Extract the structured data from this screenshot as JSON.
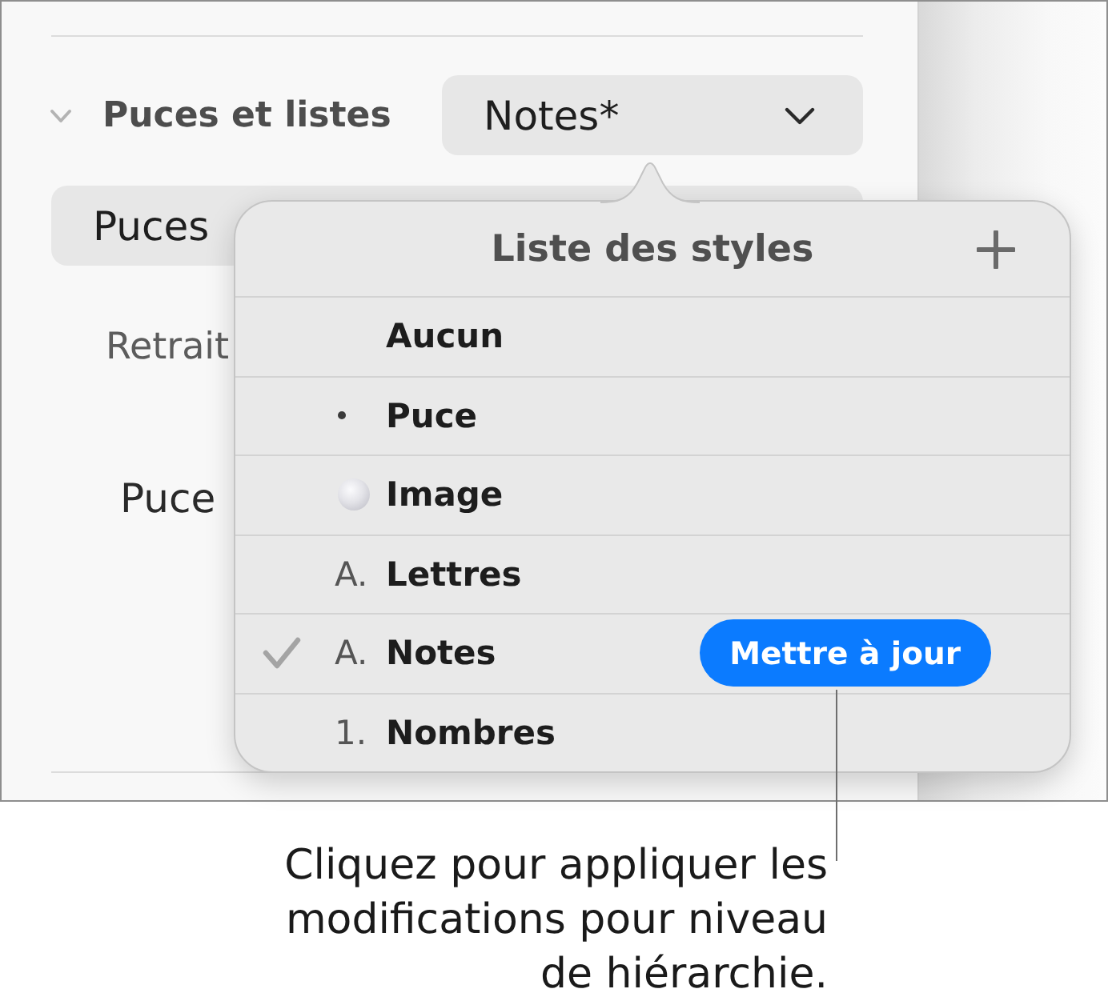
{
  "inspector": {
    "section": {
      "title": "Puces et listes",
      "expanded": true,
      "dropdown": {
        "value": "Notes*"
      }
    },
    "type_button": {
      "label": "Puces"
    },
    "labels": [
      {
        "kind": "heading",
        "text": "Retrait"
      },
      {
        "kind": "field",
        "text": "Puce"
      }
    ]
  },
  "popover": {
    "title": "Liste des styles",
    "styles": [
      {
        "kind": "none",
        "label": "Aucun",
        "selected": false
      },
      {
        "kind": "bullet",
        "label": "Puce",
        "selected": false
      },
      {
        "kind": "image",
        "label": "Image",
        "selected": false
      },
      {
        "kind": "text",
        "marker": "A.",
        "label": "Lettres",
        "selected": false
      },
      {
        "kind": "text",
        "marker": "A.",
        "label": "Notes",
        "selected": true,
        "update_button": "Mettre à jour"
      },
      {
        "kind": "text",
        "marker": "1.",
        "label": "Nombres",
        "selected": false
      }
    ]
  },
  "callout": {
    "text": "Cliquez pour appliquer les modifications pour niveau de hiérarchie."
  }
}
